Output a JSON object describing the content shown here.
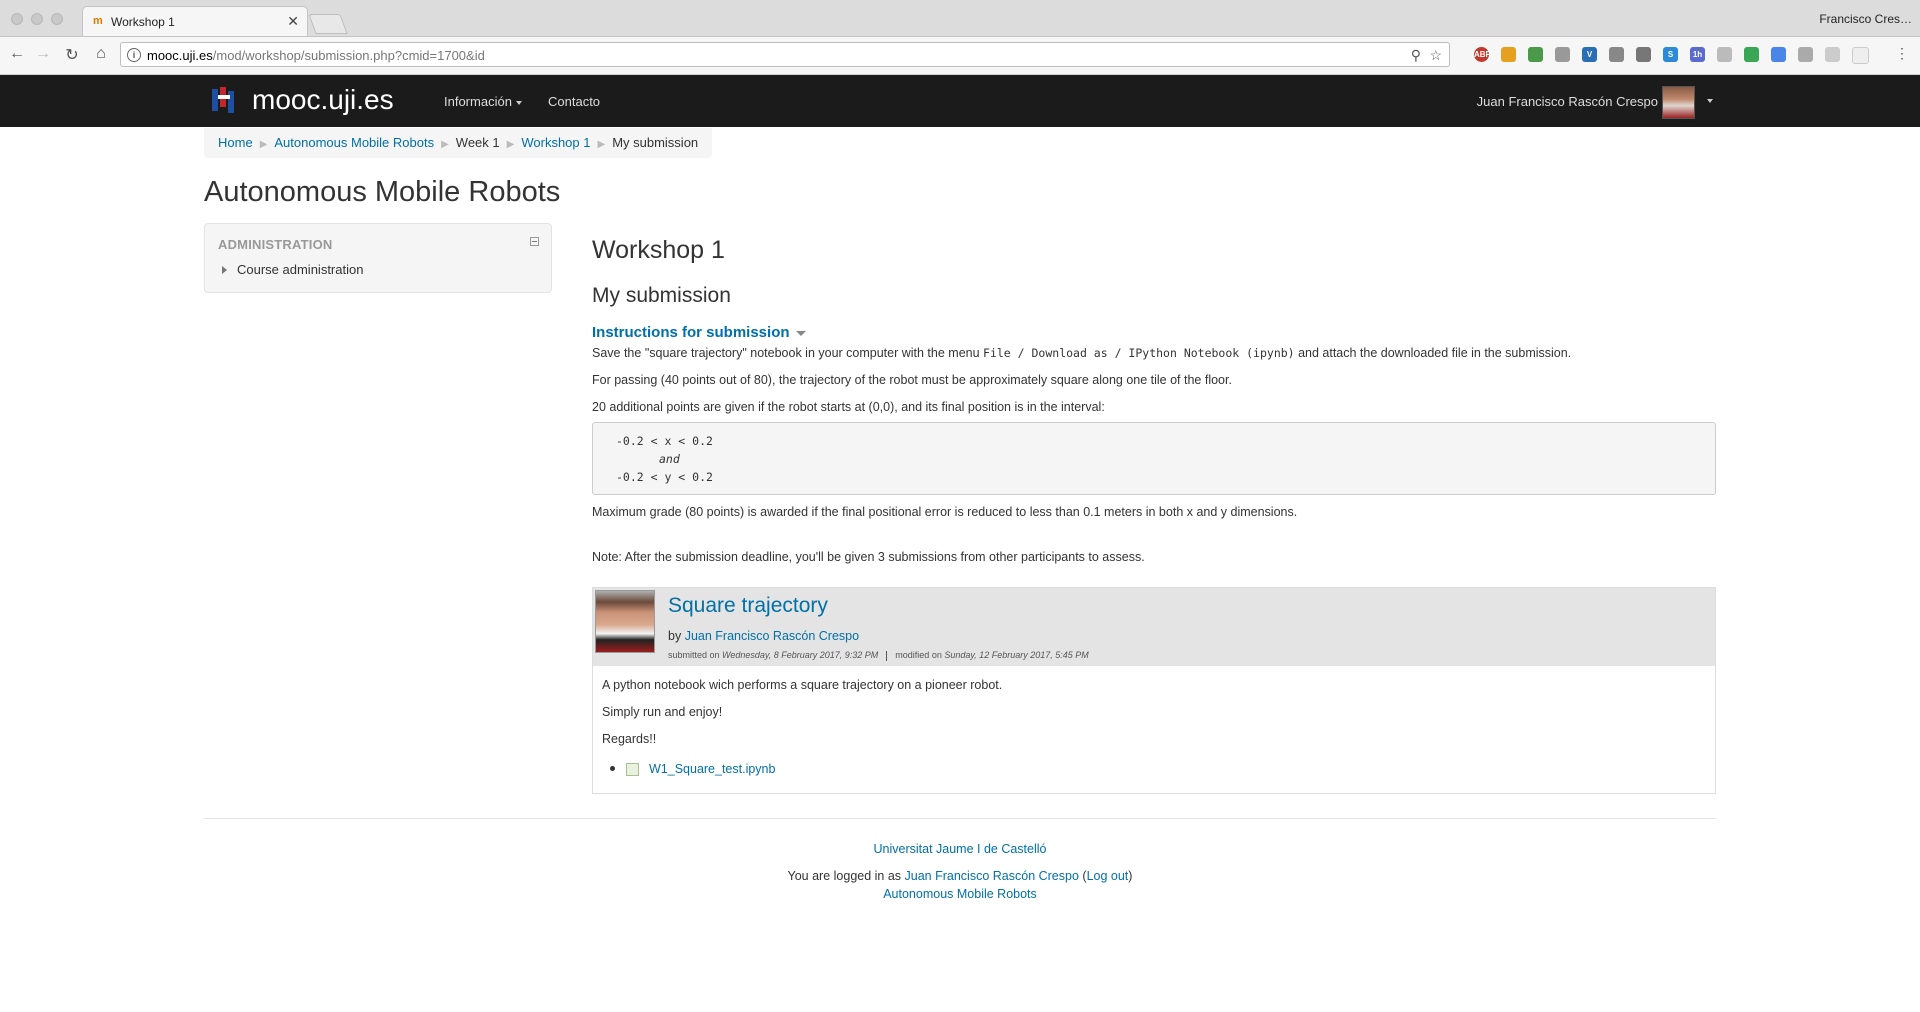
{
  "browser": {
    "tab_title": "Workshop 1",
    "tab_favicon": "m",
    "profile_name": "Francisco Cres…",
    "url_host": "mooc.uji.es",
    "url_path": "/mod/workshop/submission.php?cmid=1700&id",
    "extensions": [
      "abp-icon",
      "key-icon",
      "puzzle-icon",
      "camera-icon",
      "v-icon",
      "clipboard-icon",
      "shield-icon",
      "s-icon",
      "calendar-icon",
      "cloud-icon",
      "drive-icon",
      "translate-icon",
      "screenshot-icon",
      "rss-icon",
      "blank-icon",
      "menu-icon"
    ]
  },
  "navbar": {
    "brand": "mooc.uji.es",
    "menu": [
      {
        "label": "Información"
      },
      {
        "label": "Contacto"
      }
    ],
    "user_name": "Juan Francisco Rascón Crespo"
  },
  "breadcrumb": {
    "items": [
      "Home",
      "Autonomous Mobile Robots",
      "Week 1",
      "Workshop 1",
      "My submission"
    ]
  },
  "page_title": "Autonomous Mobile Robots",
  "admin_block": {
    "title": "ADMINISTRATION",
    "item": "Course administration"
  },
  "main": {
    "heading": "Workshop 1",
    "subheading": "My submission",
    "instructions_toggle": "Instructions for submission",
    "instructions": {
      "p1_a": "Save the \"square trajectory\" notebook in your computer with the menu ",
      "p1_code": "File / Download as / IPython Notebook (ipynb)",
      "p1_b": " and attach the downloaded file in the submission.",
      "p2": "For passing (40 points out of 80), the trajectory of the robot must be approximately square along one tile of the floor.",
      "p3": "20 additional points are given if the robot starts at (0,0), and its final position is in the interval:",
      "code_line1": "-0.2 < x < 0.2",
      "code_line2": "and",
      "code_line3": "-0.2 < y < 0.2",
      "p4": "Maximum grade (80 points) is awarded if the final positional error is reduced to less than 0.1 meters in both x and y dimensions.",
      "p5": "Note: After the submission deadline, you'll be given 3 submissions from other participants to assess."
    },
    "submission": {
      "title": "Square trajectory",
      "by_label": "by ",
      "author": "Juan Francisco Rascón Crespo",
      "submitted_label": "submitted on ",
      "submitted_date": "Wednesday, 8 February 2017, 9:32 PM",
      "modified_label": "modified on ",
      "modified_date": "Sunday, 12 February 2017, 5:45 PM",
      "body": [
        "A python notebook wich performs a square trajectory on a pioneer robot.",
        "Simply run and enjoy!",
        "Regards!!"
      ],
      "attachment": "W1_Square_test.ipynb"
    }
  },
  "footer": {
    "university": "Universitat Jaume I de Castelló",
    "logged_in_prefix": "You are logged in as ",
    "logged_in_user": "Juan Francisco Rascón Crespo",
    "logout_open": " (",
    "logout": "Log out",
    "logout_close": ")",
    "course_link": "Autonomous Mobile Robots"
  }
}
